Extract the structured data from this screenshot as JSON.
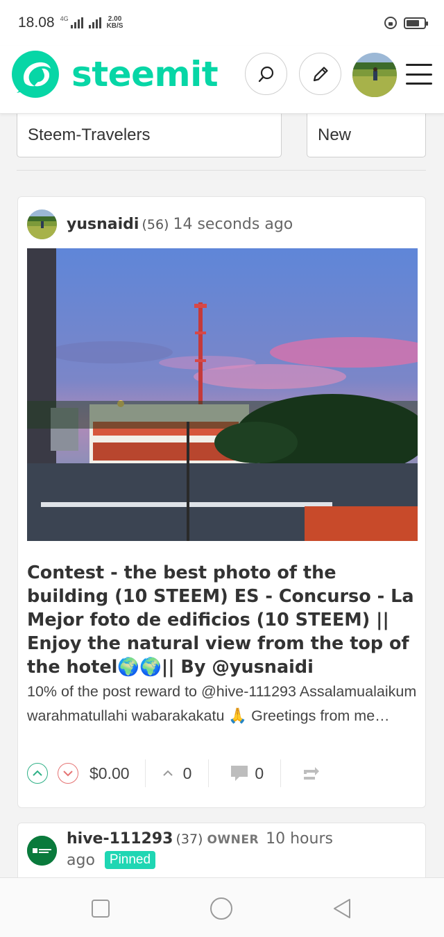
{
  "status_bar": {
    "time": "18.08",
    "network": "4G",
    "speed_value": "2.00",
    "speed_unit": "KB/S",
    "battery_percent": 75
  },
  "header": {
    "brand": "steemit",
    "icons": [
      "steemit-logo-icon",
      "search-icon",
      "pencil-icon",
      "avatar",
      "hamburger-menu-icon"
    ],
    "brand_color": "#07d6a6"
  },
  "filters": {
    "community": "Steem-Travelers",
    "sort": "New"
  },
  "posts": [
    {
      "author": "yusnaidi",
      "reputation": "(56)",
      "time": "14 seconds ago",
      "title": "Contest - the best photo of the building (10 STEEM) ES - Concurso - La Mejor foto de edificios (10 STEEM) || Enjoy the natural view from the top of the hotel🌍🌍|| By @yusnaidi",
      "summary": "10% of the post reward to @hive-111293 Assalamualaikum warahmatullahi wabarakakatu 🙏 Greetings from me…",
      "payout": "$0.00",
      "votes": "0",
      "comments": "0"
    },
    {
      "author": "hive-111293",
      "reputation": "(37)",
      "role": "OWNER",
      "time_part1": "10 hours",
      "time_part2": "ago",
      "badge": "Pinned"
    }
  ],
  "colors": {
    "accent": "#07d6a6",
    "upvote": "#2eb086",
    "downvote": "#e57373",
    "pinned": "#1fd6b3"
  }
}
